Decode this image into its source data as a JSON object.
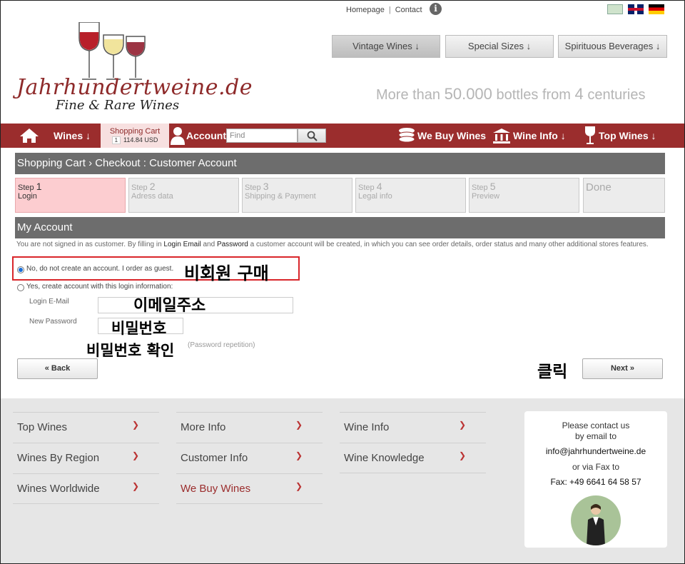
{
  "top_links": {
    "homepage": "Homepage",
    "separator": "|",
    "contact": "Contact"
  },
  "logo": {
    "name": "Jahrhundertweine.de",
    "tagline": "Fine & Rare Wines"
  },
  "header_buttons": [
    {
      "label": "Vintage Wines ↓"
    },
    {
      "label": "Special Sizes  ↓"
    },
    {
      "label": "Spirituous Beverages  ↓"
    }
  ],
  "header_tagline": {
    "pre": "More than ",
    "num1": "50.000",
    "mid": " bottles from ",
    "num2": "4",
    "post": " centuries"
  },
  "nav": {
    "wines": "Wines ↓",
    "cart_title": "Shopping Cart",
    "cart_count": "1",
    "cart_amount": "114.84 USD",
    "account": "Account",
    "search_placeholder": "Find",
    "we_buy": "We Buy Wines",
    "wine_info": "Wine Info  ↓",
    "top_wines": "Top Wines  ↓"
  },
  "page_title": "Shopping Cart › Checkout : Customer Account",
  "steps": [
    {
      "prefix": "Step ",
      "num": "1",
      "label": "Login"
    },
    {
      "prefix": "Step ",
      "num": "2",
      "label": "Adress data"
    },
    {
      "prefix": "Step ",
      "num": "3",
      "label": "Shipping & Payment"
    },
    {
      "prefix": "Step ",
      "num": "4",
      "label": "Legal info"
    },
    {
      "prefix": "Step ",
      "num": "5",
      "label": "Preview"
    },
    {
      "prefix": "",
      "num": "",
      "label": "Done"
    }
  ],
  "my_account": {
    "title": "My Account",
    "notice_1": "You are not signed in as customer. By filling in ",
    "notice_email": "Login Email",
    "notice_2": " and ",
    "notice_pw": "Password",
    "notice_3": " a customer account will be created, in which you can see order details, order status and many other additional stores features.",
    "option_guest": "No, do not create an account. I order as guest.",
    "option_create": "Yes, create account with this login information:",
    "login_email_label": "Login E-Mail",
    "new_password_label": "New Password",
    "password_repeat_hint": "(Password repetition)",
    "back_button": "« Back",
    "next_button": "Next »"
  },
  "annotations": {
    "guest_purchase": "비회원 구매",
    "email_address": "이메일주소",
    "password": "비밀번호",
    "password_confirm": "비밀번호 확인",
    "click": "클릭"
  },
  "footer": {
    "col1": [
      "Top Wines",
      "Wines By Region",
      "Wines Worldwide"
    ],
    "col2": [
      "More Info",
      "Customer Info",
      "We Buy Wines"
    ],
    "col3": [
      "Wine Info",
      "Wine Knowledge"
    ],
    "contact": {
      "line1": "Please contact us",
      "line2": "by email to",
      "email": "info@jahrhundertweine.de",
      "line3": "or via Fax to",
      "fax": "Fax: +49 6641 64 58 57"
    }
  },
  "colors": {
    "brand_red": "#9b2d2d",
    "active_step": "#fccdd0",
    "annotation_box": "#d9262b"
  }
}
